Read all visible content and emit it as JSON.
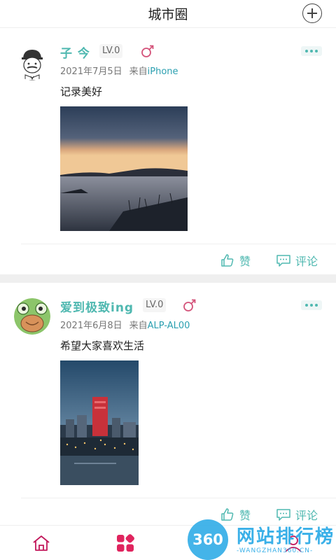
{
  "header": {
    "title": "城市圈",
    "add_icon": "plus-circle-icon"
  },
  "posts": [
    {
      "user": "子 今",
      "level": "LV.0",
      "gender_icon": "female-symbol-icon",
      "more_icon": "ellipsis-icon",
      "date": "2021年7月5日",
      "from_label": "来自",
      "device": "iPhone",
      "text": "记录美好",
      "image": "lake-sunset-photo",
      "like_label": "赞",
      "comment_label": "评论"
    },
    {
      "user": "爱到极致ing",
      "level": "LV.0",
      "gender_icon": "female-symbol-icon",
      "more_icon": "ellipsis-icon",
      "date": "2021年6月8日",
      "from_label": "来自",
      "device": "ALP-AL00",
      "text": "希望大家喜欢生活",
      "image": "city-night-photo",
      "like_label": "赞",
      "comment_label": "评论"
    }
  ],
  "tabbar": {
    "icons": [
      "home-icon",
      "grid-icon",
      "profile-icon"
    ],
    "active_color": "#e0245e",
    "inactive_color": "#c2185b"
  },
  "watermark": {
    "badge": "360",
    "title": "网站排行榜",
    "subtitle": "-WANGZHAN360.CN-"
  },
  "colors": {
    "accent": "#4fb8b0",
    "device": "#2a9fb0",
    "separator": "#efefef"
  }
}
